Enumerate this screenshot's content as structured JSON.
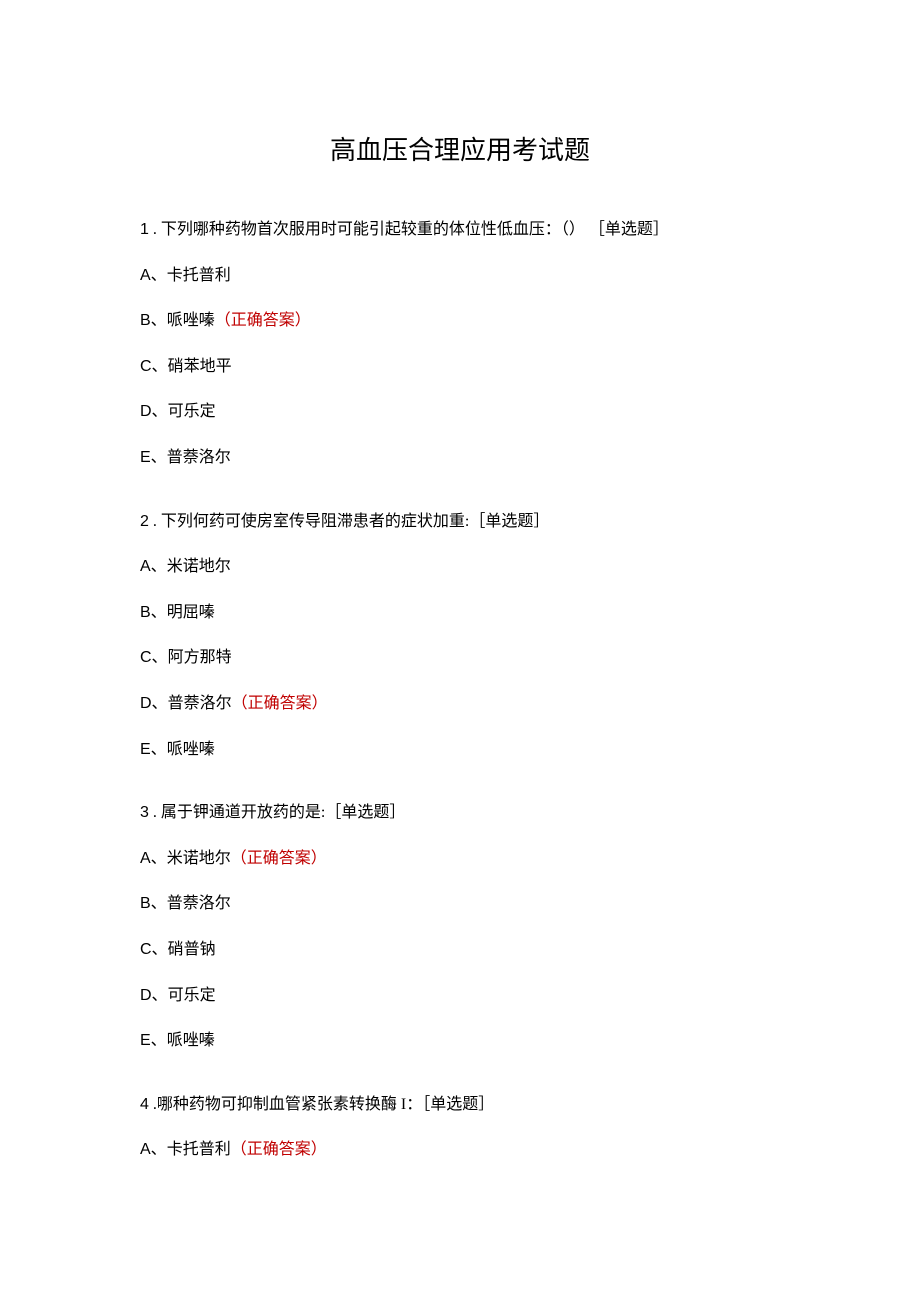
{
  "title": "高血压合理应用考试题",
  "questions": [
    {
      "number": "1",
      "sep": " . ",
      "text": "下列哪种药物首次服用时可能引起较重的体位性低血压：（） ［单选题］",
      "options": [
        {
          "letter": "A、",
          "text": "卡托普利",
          "correct": false
        },
        {
          "letter": "B、",
          "text": "哌唑嗪",
          "correct": true
        },
        {
          "letter": "C、",
          "text": "硝苯地平",
          "correct": false
        },
        {
          "letter": "D、",
          "text": "可乐定",
          "correct": false
        },
        {
          "letter": "E、",
          "text": "普萘洛尔",
          "correct": false
        }
      ]
    },
    {
      "number": "2",
      "sep": " . ",
      "text": "下列何药可使房室传导阻滞患者的症状加重:［单选题］",
      "options": [
        {
          "letter": "A、",
          "text": "米诺地尔",
          "correct": false
        },
        {
          "letter": "B、",
          "text": "明屈嗪",
          "correct": false
        },
        {
          "letter": "C、",
          "text": "阿方那特",
          "correct": false
        },
        {
          "letter": "D、",
          "text": "普萘洛尔",
          "correct": true
        },
        {
          "letter": "E、",
          "text": "哌唑嗪",
          "correct": false
        }
      ]
    },
    {
      "number": "3",
      "sep": " . ",
      "text": "属于钾通道开放药的是:［单选题］",
      "options": [
        {
          "letter": "A、",
          "text": "米诺地尔",
          "correct": true
        },
        {
          "letter": "B、",
          "text": "普萘洛尔",
          "correct": false
        },
        {
          "letter": "C、",
          "text": "硝普钠",
          "correct": false
        },
        {
          "letter": "D、",
          "text": "可乐定",
          "correct": false
        },
        {
          "letter": "E、",
          "text": "哌唑嗪",
          "correct": false
        }
      ]
    },
    {
      "number": "4",
      "sep": " .",
      "text": "哪种药物可抑制血管紧张素转换酶 I：［单选题］",
      "options": [
        {
          "letter": "A、",
          "text": "卡托普利",
          "correct": true
        }
      ]
    }
  ],
  "correct_label": "（正确答案）"
}
